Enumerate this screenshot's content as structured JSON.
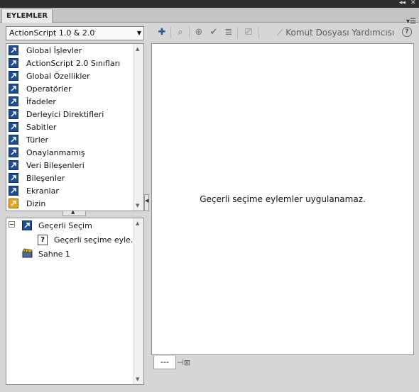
{
  "panel": {
    "title": "EYLEMLER",
    "window_controls": [
      "◂◂",
      "✕"
    ]
  },
  "version_dropdown": {
    "selected": "ActionScript 1.0 & 2.0"
  },
  "toolbox": {
    "items": [
      {
        "label": "Global İşlevler",
        "icon": "book-arrow-icon"
      },
      {
        "label": "ActionScript 2.0 Sınıfları",
        "icon": "book-arrow-icon"
      },
      {
        "label": "Global Özellikler",
        "icon": "book-arrow-icon"
      },
      {
        "label": "Operatörler",
        "icon": "book-arrow-icon"
      },
      {
        "label": "İfadeler",
        "icon": "book-arrow-icon"
      },
      {
        "label": "Derleyici Direktifleri",
        "icon": "book-arrow-icon"
      },
      {
        "label": "Sabitler",
        "icon": "book-arrow-icon"
      },
      {
        "label": "Türler",
        "icon": "book-arrow-icon"
      },
      {
        "label": "Onaylanmamış",
        "icon": "book-arrow-icon"
      },
      {
        "label": "Veri Bileşenleri",
        "icon": "book-arrow-icon"
      },
      {
        "label": "Bileşenler",
        "icon": "book-arrow-icon"
      },
      {
        "label": "Ekranlar",
        "icon": "book-arrow-icon"
      },
      {
        "label": "Dizin",
        "icon": "index-icon"
      }
    ]
  },
  "script_navigator": {
    "current_selection": "Geçerli Seçim",
    "current_selection_child": "Geçerli seçime eyle...",
    "scene": "Sahne 1"
  },
  "toolbar": {
    "buttons": [
      "add-statement-icon",
      "find-icon",
      "target-icon",
      "check-syntax-icon",
      "auto-format-icon",
      "code-hint-icon"
    ],
    "assistant_label": "Komut Dosyası Yardımcısı",
    "help": "?"
  },
  "editor": {
    "message": "Geçerli seçime eylemler uygulanamaz."
  },
  "script_tab": {
    "label": "---"
  }
}
